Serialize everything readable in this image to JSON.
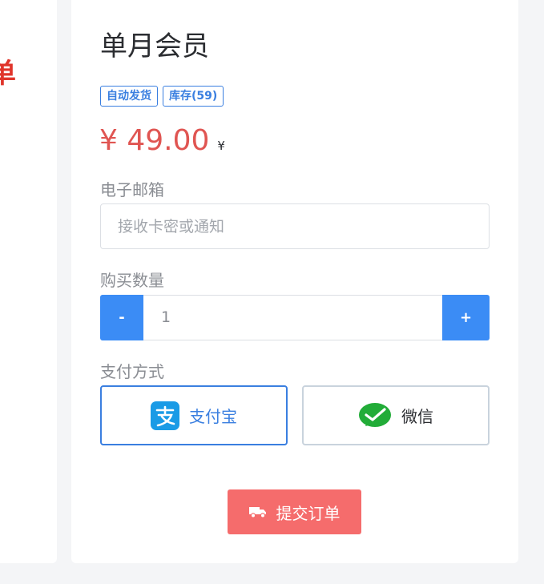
{
  "left_panel": {
    "partial_text": "单"
  },
  "product": {
    "title": "单月会员",
    "badges": [
      "自动发货",
      "库存(59)"
    ],
    "price": "¥ 49.00",
    "price_unit": "¥"
  },
  "form": {
    "email": {
      "label": "电子邮箱",
      "placeholder": "接收卡密或通知",
      "value": ""
    },
    "quantity": {
      "label": "购买数量",
      "minus_label": "-",
      "value": "1",
      "plus_label": "+"
    },
    "payment": {
      "label": "支付方式",
      "selected": "alipay",
      "options": [
        {
          "id": "alipay",
          "label": "支付宝",
          "icon": "alipay-icon"
        },
        {
          "id": "wechat",
          "label": "微信",
          "icon": "wechat-icon"
        }
      ]
    },
    "submit": {
      "label": "提交订单",
      "icon": "truck-icon"
    }
  },
  "colors": {
    "accent": "#3b8cf5",
    "price": "#e05552",
    "submit": "#f56c6c",
    "alipay": "#1a9be6",
    "wechat": "#22ac38"
  }
}
